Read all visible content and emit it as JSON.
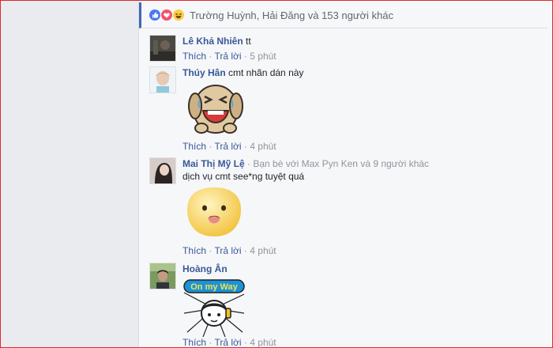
{
  "reactions": {
    "summary": "Trường Huỳnh, Hải Đăng và 153 người khác",
    "icons": [
      "like-icon",
      "love-icon",
      "haha-icon"
    ]
  },
  "comments": [
    {
      "author": "Lê Khả Nhiên",
      "text": "tt",
      "like_label": "Thích",
      "reply_label": "Trả lời",
      "time": "5 phút"
    },
    {
      "author": "Thúy Hân",
      "text": "cmt nhãn dán này",
      "sticker": "crying-dog-sticker",
      "like_label": "Thích",
      "reply_label": "Trả lời",
      "time": "4 phút"
    },
    {
      "author": "Mai Thị Mỹ Lệ",
      "friends_note": "Bạn bè với Max Pyn Ken và 9 người khác",
      "text": "dịch vụ cmt see*ng tuyệt quá",
      "sticker": "tongue-face-sticker",
      "like_label": "Thích",
      "reply_label": "Trả lời",
      "time": "4 phút"
    },
    {
      "author": "Hoàng Ân",
      "sticker_text": "On my Way",
      "sticker": "on-my-way-sticker",
      "like_label": "Thích",
      "reply_label": "Trả lời",
      "time": "4 phút"
    }
  ],
  "dot": "·",
  "colors": {
    "link": "#385898",
    "accent": "#4267b2",
    "border": "#e0282d"
  }
}
